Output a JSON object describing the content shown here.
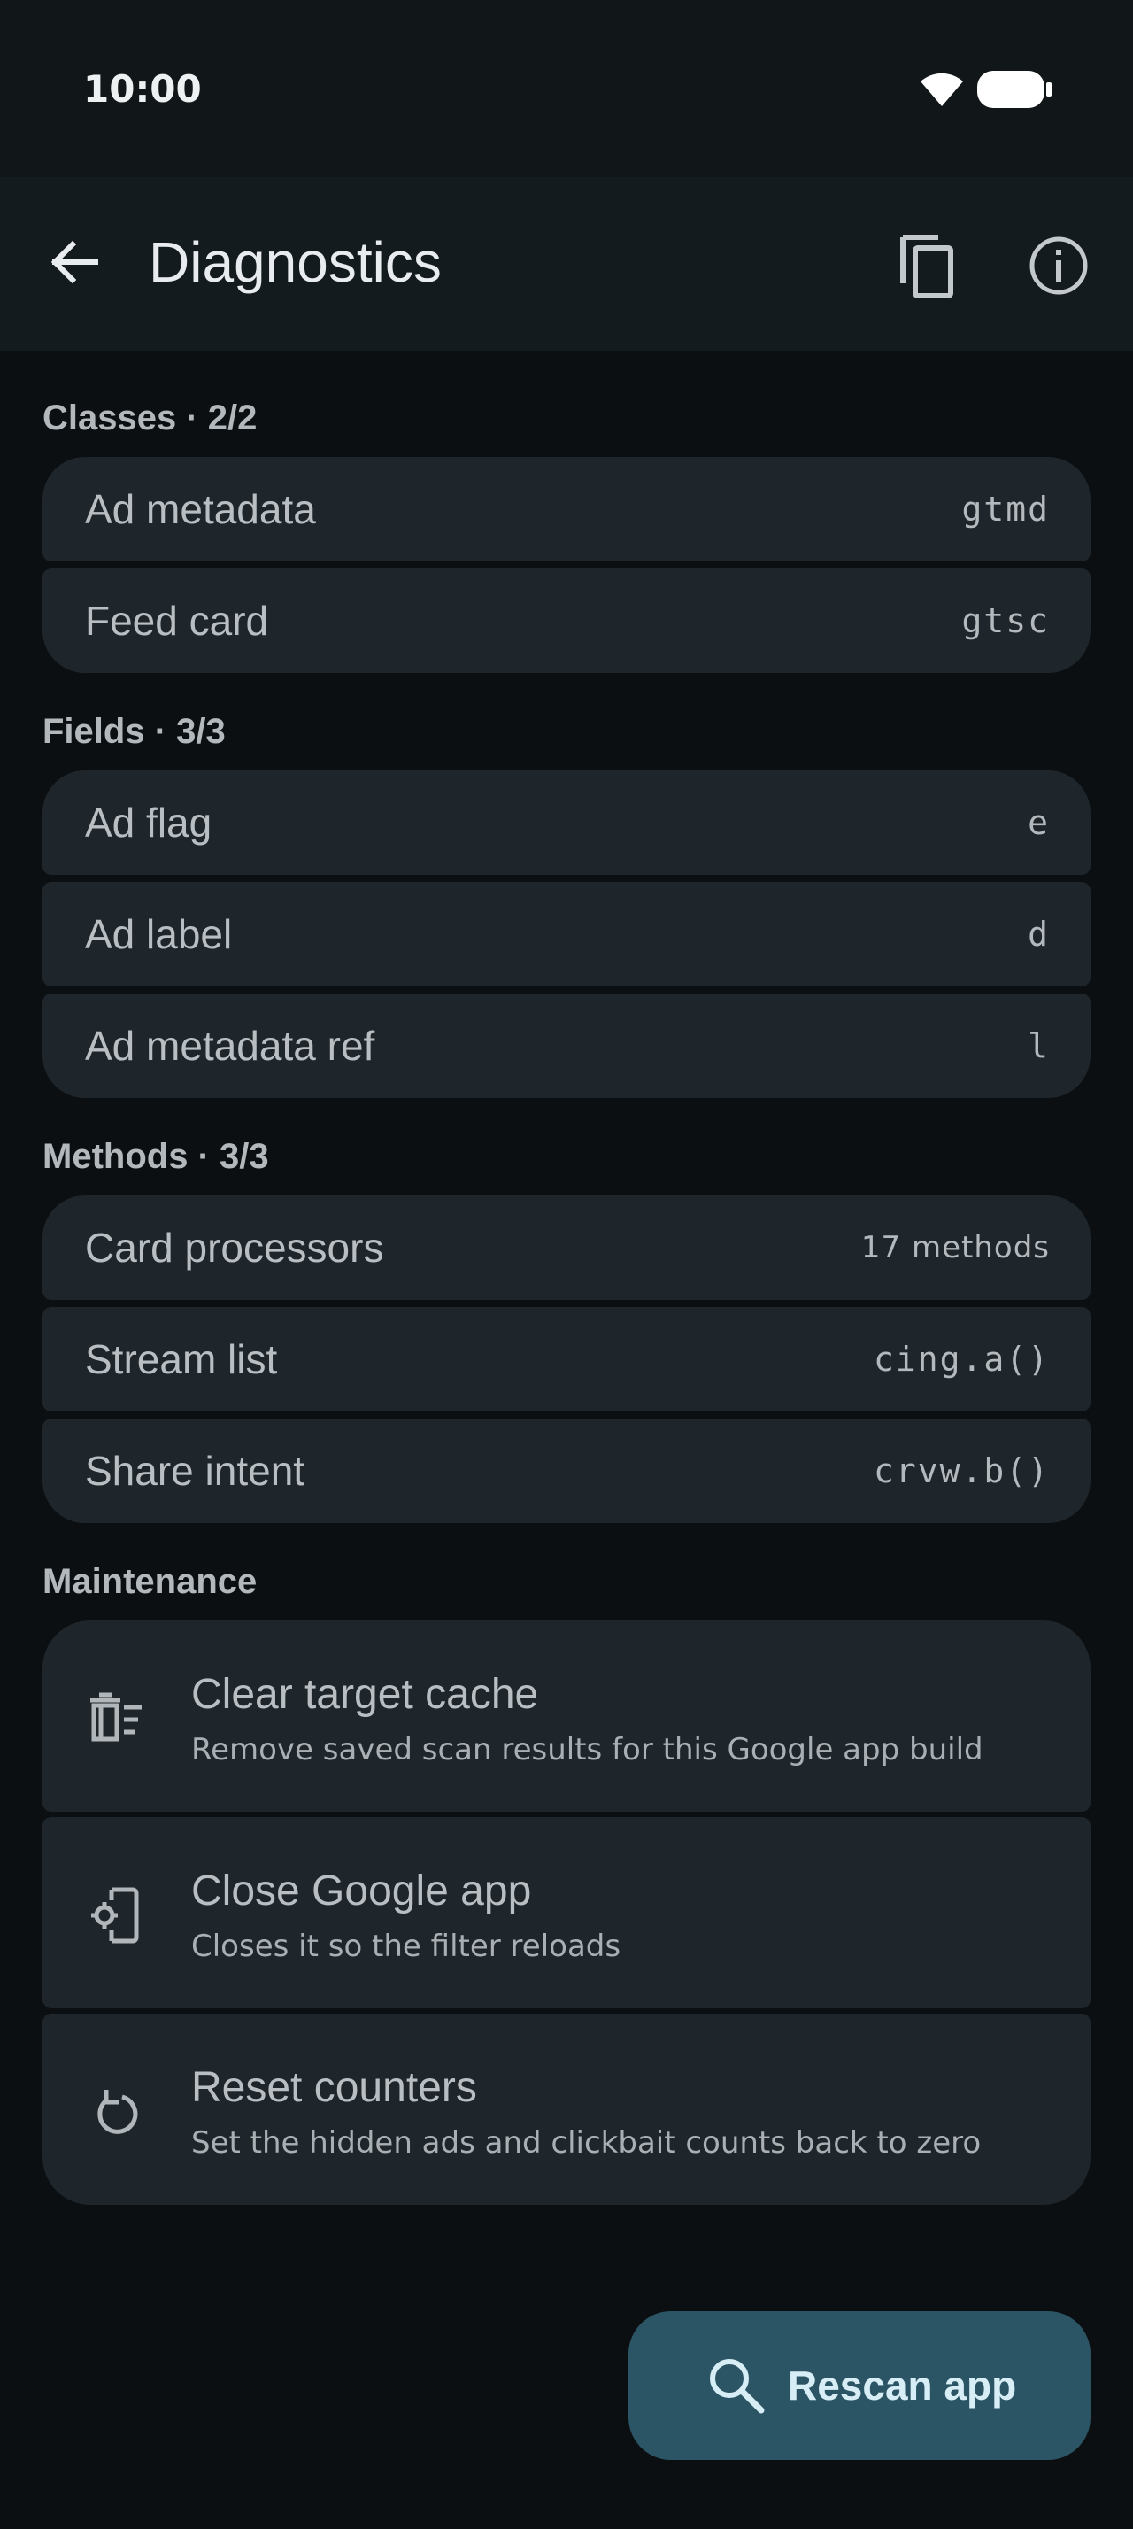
{
  "status_bar": {
    "time": "10:00"
  },
  "app_bar": {
    "title": "Diagnostics"
  },
  "sections": {
    "classes": {
      "header": "Classes · 2/2",
      "items": [
        {
          "label": "Ad metadata",
          "value": "gtmd"
        },
        {
          "label": "Feed card",
          "value": "gtsc"
        }
      ]
    },
    "fields": {
      "header": "Fields · 3/3",
      "items": [
        {
          "label": "Ad flag",
          "value": "e"
        },
        {
          "label": "Ad label",
          "value": "d"
        },
        {
          "label": "Ad metadata ref",
          "value": "l"
        }
      ]
    },
    "methods": {
      "header": "Methods · 3/3",
      "items": [
        {
          "label": "Card processors",
          "value": "17 methods"
        },
        {
          "label": "Stream list",
          "value": "cing.a()"
        },
        {
          "label": "Share intent",
          "value": "crvw.b()"
        }
      ]
    },
    "maintenance": {
      "header": "Maintenance",
      "items": [
        {
          "title": "Clear target cache",
          "subtitle": "Remove saved scan results for this Google app build",
          "icon": "delete-sweep-icon"
        },
        {
          "title": "Close Google app",
          "subtitle": "Closes it so the filter reloads",
          "icon": "phone-settings-icon"
        },
        {
          "title": "Reset counters",
          "subtitle": "Set the hidden ads and clickbait counts back to zero",
          "icon": "reset-icon"
        }
      ]
    }
  },
  "fab": {
    "label": "Rescan app",
    "icon": "search-icon"
  },
  "colors": {
    "background": "#0b0f12",
    "card": "#1f262b",
    "fab": "#2b5564",
    "fab_text": "#d8eef6"
  }
}
